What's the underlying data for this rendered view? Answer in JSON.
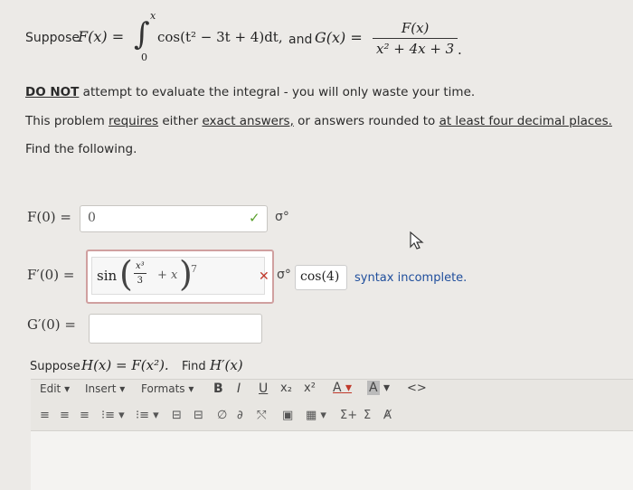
{
  "problem": {
    "suppose": "Suppose",
    "F_of_x": "F(x) =",
    "integral_upper": "x",
    "integral_lower": "0",
    "integrand": "cos(t² − 3t + 4)dt,",
    "and": "and",
    "G_of_x": "G(x) =",
    "G_num": "F(x)",
    "G_den": "x² + 4x + 3",
    "period": "."
  },
  "instructions": {
    "do_not": "DO NOT",
    "line1_rest": "attempt to evaluate the integral - you will only waste your time.",
    "line2_a": "This problem",
    "line2_requires": "requires",
    "line2_b": "either",
    "line2_exact": "exact answers,",
    "line2_c": "or answers rounded to",
    "line2_four": "at least four decimal places.",
    "line3": "Find the following."
  },
  "answers": {
    "f0_label": "F(0) =",
    "f0_value": "0",
    "fp0_label": "F′(0) =",
    "fp0_sin": "sin",
    "fp0_frac_num": "x³",
    "fp0_frac_den": "3",
    "fp0_plus_x": "+ x",
    "fp0_seven": "7",
    "fp0_preview": "cos(4)",
    "fp0_status": "syntax incomplete.",
    "gp0_label": "G′(0) ="
  },
  "part_h": {
    "text": "Suppose",
    "h_def": "H(x) = F(x²).",
    "find": "Find",
    "h_prime": "H′(x)"
  },
  "editor": {
    "menu": [
      "Edit",
      "Insert",
      "Formats"
    ],
    "format_buttons": [
      "B",
      "I",
      "U",
      "x₂",
      "x²",
      "A",
      "A",
      "<>"
    ],
    "row2_icons": [
      "≡",
      "≡",
      "≡",
      "⁝≡",
      "⁝≡",
      "⊟",
      "⊟",
      "∅",
      "∂",
      "⤲",
      "▣",
      "▦",
      "Σ+",
      "Σ",
      "Ⱥ"
    ]
  },
  "colors": {
    "correct": "#5aa02c",
    "incorrect": "#c0392b",
    "status_text": "#1f4e9c"
  }
}
